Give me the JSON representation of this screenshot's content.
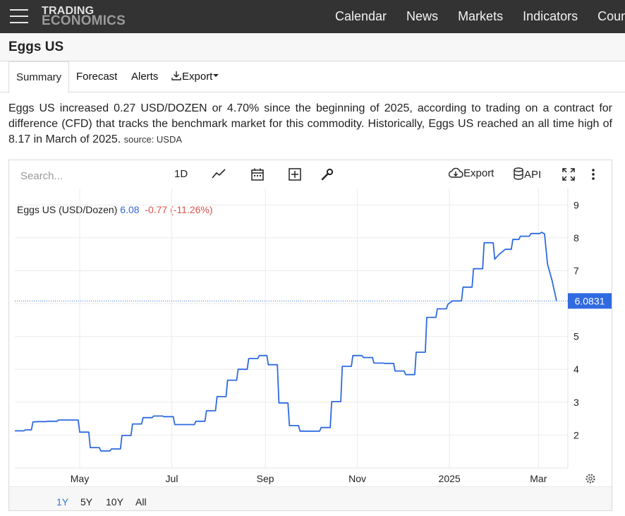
{
  "header": {
    "logo_line1": "TRADING",
    "logo_line2": "ECONOMICS",
    "nav": [
      "Calendar",
      "News",
      "Markets",
      "Indicators",
      "Countries"
    ]
  },
  "page": {
    "title": "Eggs US"
  },
  "tabs": {
    "summary": "Summary",
    "forecast": "Forecast",
    "alerts": "Alerts",
    "export": "Export"
  },
  "description": {
    "text": "Eggs US increased 0.27 USD/DOZEN or 4.70% since the beginning of 2025, according to trading on a contract for difference (CFD) that tracks the benchmark market for this commodity. Historically, Eggs US reached an all time high of 8.17 in March of 2025.",
    "source": "source: USDA"
  },
  "toolbar": {
    "search_placeholder": "Search...",
    "interval": "1D",
    "export": "Export",
    "api": "API"
  },
  "legend": {
    "name": "Eggs US (USD/Dozen)",
    "value": "6.08",
    "change": "-0.77 (-11.26%)"
  },
  "ranges": [
    "1Y",
    "5Y",
    "10Y",
    "All"
  ],
  "colors": {
    "line": "#2f6ae0",
    "accent": "#2f7ad6",
    "negative": "#d9534f"
  },
  "chart_data": {
    "type": "line",
    "series": [
      {
        "name": "Eggs US (USD/Dozen)",
        "x": [
          "2024-03-19",
          "2024-03-26",
          "2024-03-31",
          "2024-04-03",
          "2024-04-10",
          "2024-04-17",
          "2024-04-20",
          "2024-04-30",
          "2024-05-01",
          "2024-05-08",
          "2024-05-15",
          "2024-05-22",
          "2024-05-29",
          "2024-06-05",
          "2024-06-12",
          "2024-06-19",
          "2024-06-26",
          "2024-07-03",
          "2024-07-10",
          "2024-07-17",
          "2024-07-24",
          "2024-07-31",
          "2024-08-07",
          "2024-08-14",
          "2024-08-21",
          "2024-08-28",
          "2024-09-03",
          "2024-09-10",
          "2024-09-17",
          "2024-09-24",
          "2024-10-01",
          "2024-10-08",
          "2024-10-15",
          "2024-10-22",
          "2024-10-29",
          "2024-11-05",
          "2024-11-12",
          "2024-11-19",
          "2024-11-26",
          "2024-12-03",
          "2024-12-10",
          "2024-12-17",
          "2024-12-24",
          "2024-12-31",
          "2025-01-03",
          "2025-01-10",
          "2025-01-17",
          "2025-01-24",
          "2025-01-31",
          "2025-02-03",
          "2025-02-07",
          "2025-02-12",
          "2025-02-17",
          "2025-02-24",
          "2025-03-03",
          "2025-03-05",
          "2025-03-07",
          "2025-03-10",
          "2025-03-13"
        ],
        "values": [
          2.13,
          2.16,
          2.4,
          2.41,
          2.42,
          2.46,
          2.46,
          2.46,
          2.09,
          1.62,
          1.52,
          1.58,
          1.99,
          2.34,
          2.53,
          2.58,
          2.56,
          2.32,
          2.32,
          2.42,
          2.74,
          3.17,
          3.67,
          4.0,
          4.33,
          4.42,
          4.14,
          2.98,
          2.29,
          2.12,
          2.12,
          2.23,
          3.02,
          4.09,
          4.42,
          4.36,
          4.19,
          4.18,
          3.95,
          3.84,
          4.52,
          5.58,
          5.84,
          5.98,
          6.08,
          6.5,
          7.06,
          7.85,
          7.35,
          7.5,
          7.65,
          7.95,
          8.05,
          8.13,
          8.17,
          8.12,
          7.2,
          6.7,
          6.08
        ]
      }
    ],
    "x_ticks": [
      "May",
      "Jul",
      "Sep",
      "Nov",
      "2025",
      "Mar"
    ],
    "y_ticks": [
      2,
      3,
      4,
      5,
      6,
      7,
      8,
      9
    ],
    "ylim": [
      1,
      9.5
    ],
    "current_value_label": "6.0831",
    "grid": true
  }
}
